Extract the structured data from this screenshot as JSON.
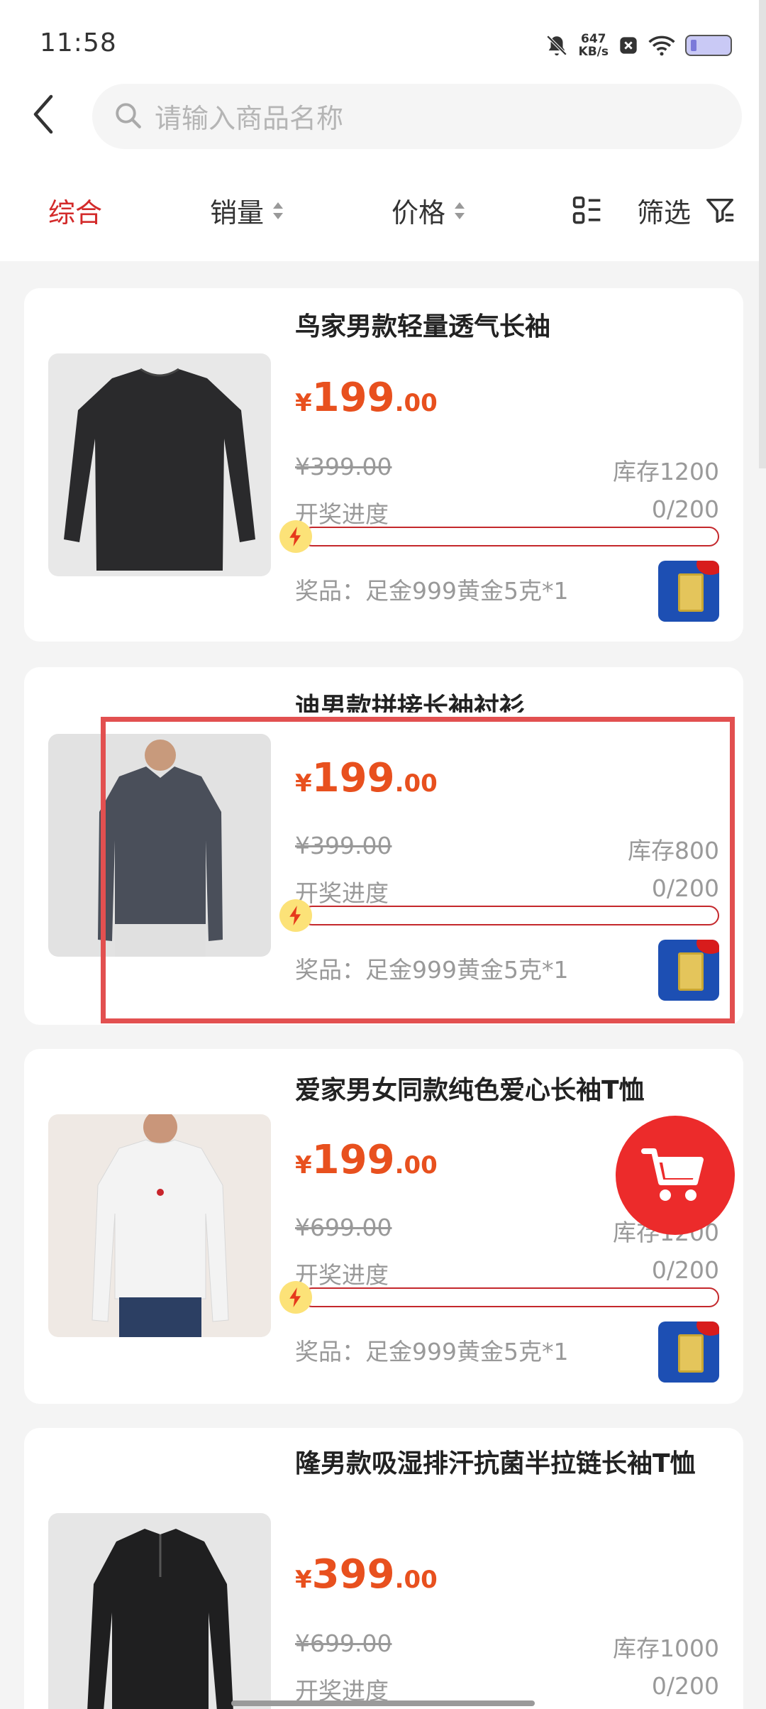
{
  "status_bar": {
    "time": "11:58",
    "speed_value": "647",
    "speed_unit": "KB/s"
  },
  "search": {
    "placeholder": "请输入商品名称"
  },
  "filters": {
    "comprehensive": "综合",
    "sales": "销量",
    "price": "价格",
    "filter": "筛选"
  },
  "products": [
    {
      "title": "鸟家男款轻量透气长袖",
      "currency": "¥",
      "price_int": "199",
      "price_dec": ".00",
      "original_price": "¥399.00",
      "stock": "库存1200",
      "progress_label": "开奖进度",
      "progress_value": "0/200",
      "progress_fraction": 0,
      "prize": "奖品：足金999黄金5克*1"
    },
    {
      "title": "迪男款拼接长袖衬衫",
      "currency": "¥",
      "price_int": "199",
      "price_dec": ".00",
      "original_price": "¥399.00",
      "stock": "库存800",
      "progress_label": "开奖进度",
      "progress_value": "0/200",
      "progress_fraction": 0,
      "prize": "奖品：足金999黄金5克*1"
    },
    {
      "title": "爱家男女同款纯色爱心长袖T恤",
      "currency": "¥",
      "price_int": "199",
      "price_dec": ".00",
      "original_price": "¥699.00",
      "stock": "库存1200",
      "progress_label": "开奖进度",
      "progress_value": "0/200",
      "progress_fraction": 0,
      "prize": "奖品：足金999黄金5克*1"
    },
    {
      "title": "隆男款吸湿排汗抗菌半拉链长袖T恤",
      "currency": "¥",
      "price_int": "399",
      "price_dec": ".00",
      "original_price": "¥699.00",
      "stock": "库存1000",
      "progress_label": "开奖进度",
      "progress_value": "0/200",
      "progress_fraction": 0
    }
  ],
  "colors": {
    "accent": "#d32a2a",
    "price": "#e8501e",
    "cart": "#ec2b2b",
    "highlight": "#e25050"
  }
}
